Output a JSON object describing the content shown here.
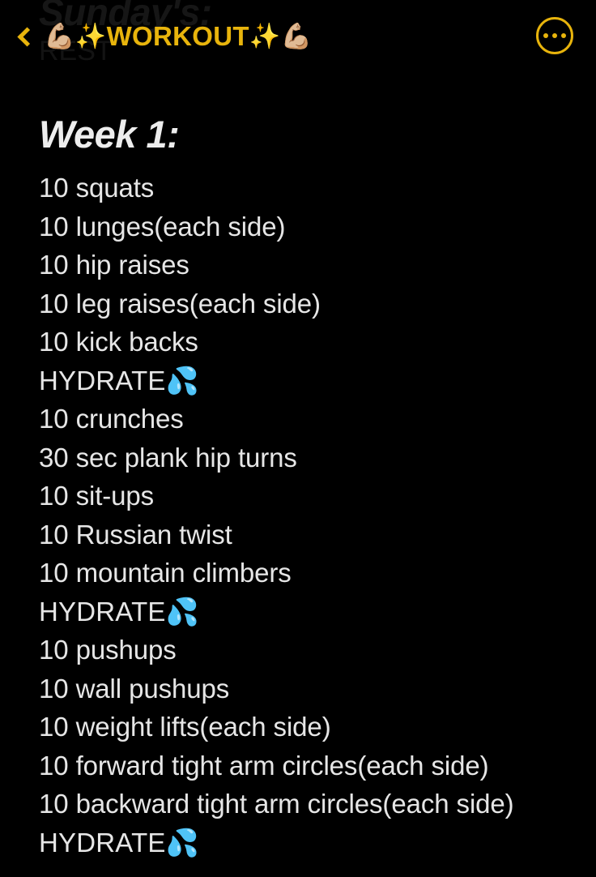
{
  "app": {
    "background_color": "#000000",
    "accent_color": "#E8B40C",
    "text_color": "#E6E6E6"
  },
  "ghost": {
    "title": "Sunday's:",
    "subtitle": "REST"
  },
  "navbar": {
    "back_icon": "chevron-left-icon",
    "title_prefix_emoji": "💪🏼✨",
    "title_text": "WORKOUT",
    "title_suffix_emoji": "✨💪🏼",
    "title_full": "💪🏼✨WORKOUT✨💪🏼",
    "menu_icon": "ellipsis-circle-icon"
  },
  "note": {
    "heading": "Week 1:",
    "items": [
      {
        "text": "10 squats",
        "hydrate": false
      },
      {
        "text": "10 lunges(each side)",
        "hydrate": false
      },
      {
        "text": "10 hip raises",
        "hydrate": false
      },
      {
        "text": "10 leg raises(each side)",
        "hydrate": false
      },
      {
        "text": "10 kick backs",
        "hydrate": false
      },
      {
        "text": "HYDRATE💦",
        "hydrate": true
      },
      {
        "text": "10 crunches",
        "hydrate": false
      },
      {
        "text": "30 sec plank hip turns",
        "hydrate": false
      },
      {
        "text": "10 sit-ups",
        "hydrate": false
      },
      {
        "text": "10 Russian twist",
        "hydrate": false
      },
      {
        "text": "10 mountain climbers",
        "hydrate": false
      },
      {
        "text": "HYDRATE💦",
        "hydrate": true
      },
      {
        "text": "10 pushups",
        "hydrate": false
      },
      {
        "text": "10 wall pushups",
        "hydrate": false
      },
      {
        "text": "10 weight lifts(each side)",
        "hydrate": false
      },
      {
        "text": "10 forward tight arm circles(each side)",
        "hydrate": false
      },
      {
        "text": "10 backward tight arm circles(each side)",
        "hydrate": false
      },
      {
        "text": "HYDRATE💦",
        "hydrate": true
      }
    ]
  }
}
